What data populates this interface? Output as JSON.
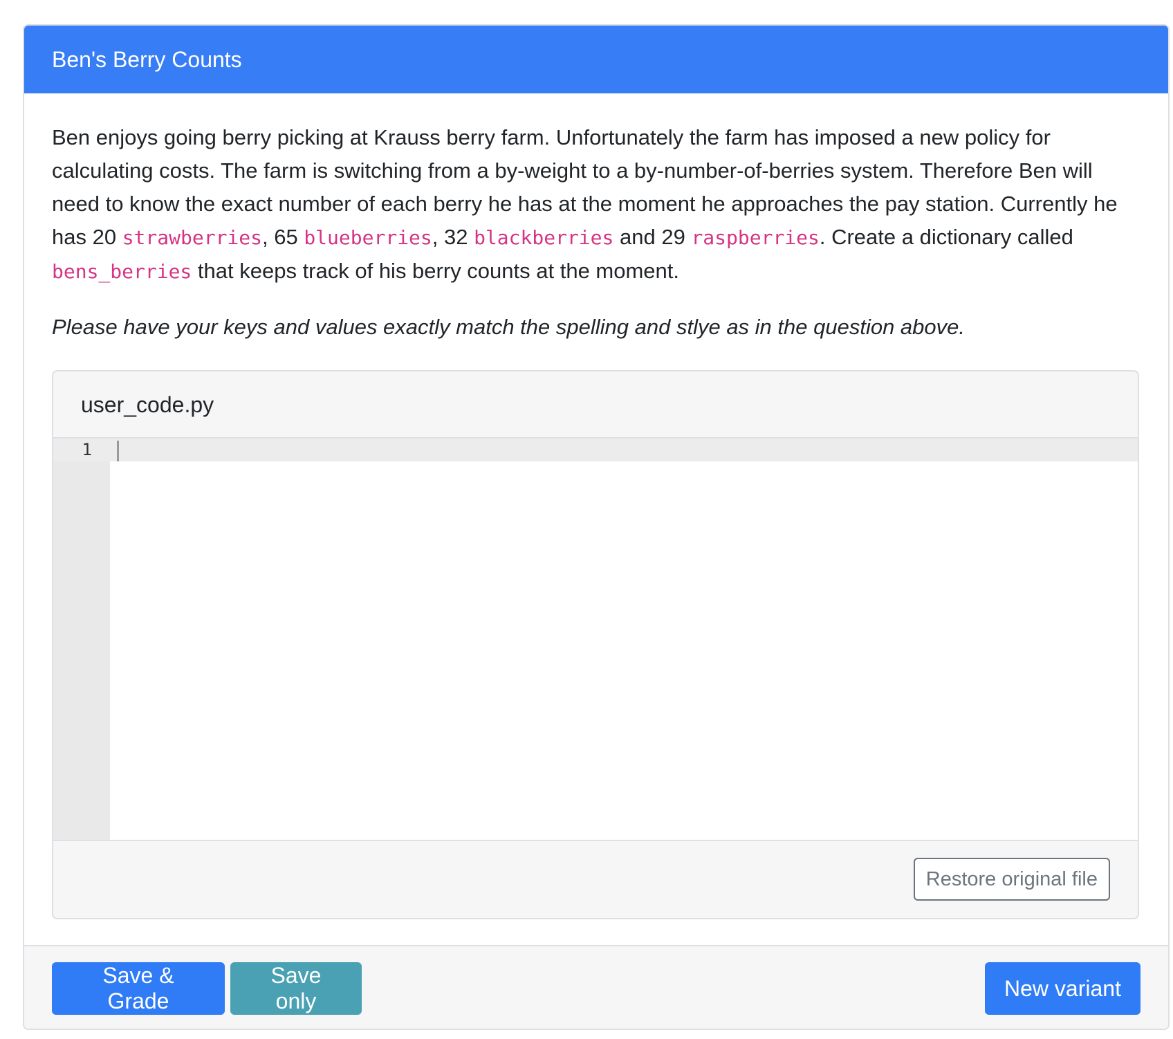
{
  "question": {
    "title": "Ben's Berry Counts",
    "prompt": {
      "p1": "Ben enjoys going berry picking at Krauss berry farm. Unfortunately the farm has imposed a new policy for calculating costs. The farm is switching from a by-weight to a by-number-of-berries system. Therefore Ben will need to know the exact number of each berry he has at the moment he approaches the pay station. Currently he has 20 ",
      "code1": "strawberries",
      "p2": ", 65 ",
      "code2": "blueberries",
      "p3": ", 32 ",
      "code3": "blackberries",
      "p4": " and 29 ",
      "code4": "raspberries",
      "p5": ". Create a dictionary called ",
      "code5": "bens_berries",
      "p6": " that keeps track of his berry counts at the moment."
    },
    "note": "Please have your keys and values exactly match the spelling and stlye as in the question above."
  },
  "editor": {
    "filename": "user_code.py",
    "line_numbers": [
      "1"
    ],
    "content": "",
    "restore_label": "Restore original file"
  },
  "footer": {
    "save_grade_label": "Save & Grade",
    "save_only_label": "Save only",
    "new_variant_label": "New variant"
  },
  "colors": {
    "header_bg": "#367df6",
    "code_text": "#d63384",
    "primary_button": "#2f7cf6",
    "info_button": "#4aa1b4"
  }
}
